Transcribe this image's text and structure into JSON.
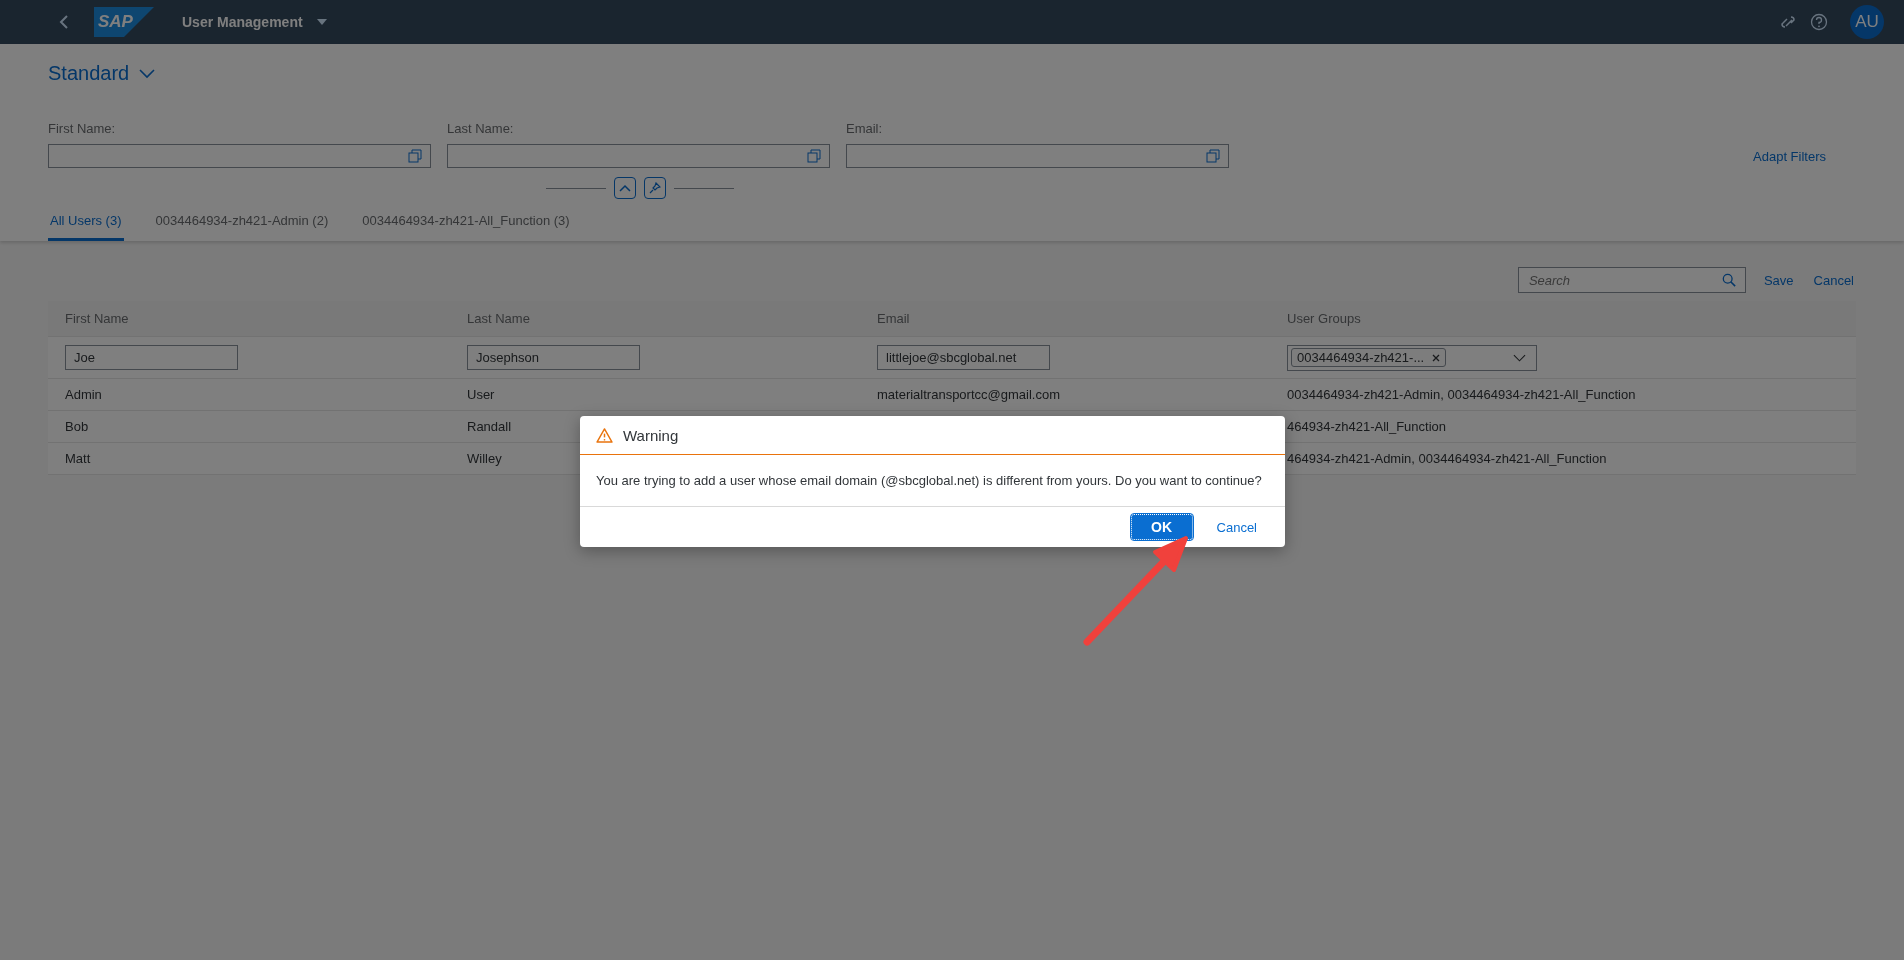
{
  "shell": {
    "logo": "SAP",
    "title": "User Management",
    "avatar": "AU"
  },
  "variant": {
    "title": "Standard"
  },
  "filters": [
    {
      "label": "First Name:"
    },
    {
      "label": "Last Name:"
    },
    {
      "label": "Email:"
    }
  ],
  "adapt_filters": "Adapt Filters",
  "tabs": [
    {
      "label": "All Users (3)",
      "selected": true
    },
    {
      "label": "0034464934-zh421-Admin (2)",
      "selected": false
    },
    {
      "label": "0034464934-zh421-All_Function (3)",
      "selected": false
    }
  ],
  "toolbar": {
    "search_placeholder": "Search",
    "save": "Save",
    "cancel": "Cancel"
  },
  "table": {
    "columns": [
      "First Name",
      "Last Name",
      "Email",
      "User Groups"
    ],
    "rows": [
      {
        "kind": "edit",
        "first": "Joe",
        "last": "Josephson",
        "email": "littlejoe@sbcglobal.net",
        "groups": "0034464934-zh421-..."
      },
      {
        "kind": "view",
        "first": "Admin",
        "last": "User",
        "email": "materialtransportcc@gmail.com",
        "groups": "0034464934-zh421-Admin, 0034464934-zh421-All_Function"
      },
      {
        "kind": "view",
        "first": "Bob",
        "last": "Randall",
        "groups": "464934-zh421-All_Function"
      },
      {
        "kind": "view",
        "first": "Matt",
        "last": "Willey",
        "groups": "464934-zh421-Admin, 0034464934-zh421-All_Function"
      }
    ]
  },
  "dialog": {
    "title": "Warning",
    "message": "You are trying to add a user whose email domain (@sbcglobal.net) is different from yours. Do you want to continue?",
    "buttons": [
      {
        "label": "OK",
        "kind": "primary"
      },
      {
        "label": "Cancel",
        "kind": "secondary"
      }
    ]
  }
}
